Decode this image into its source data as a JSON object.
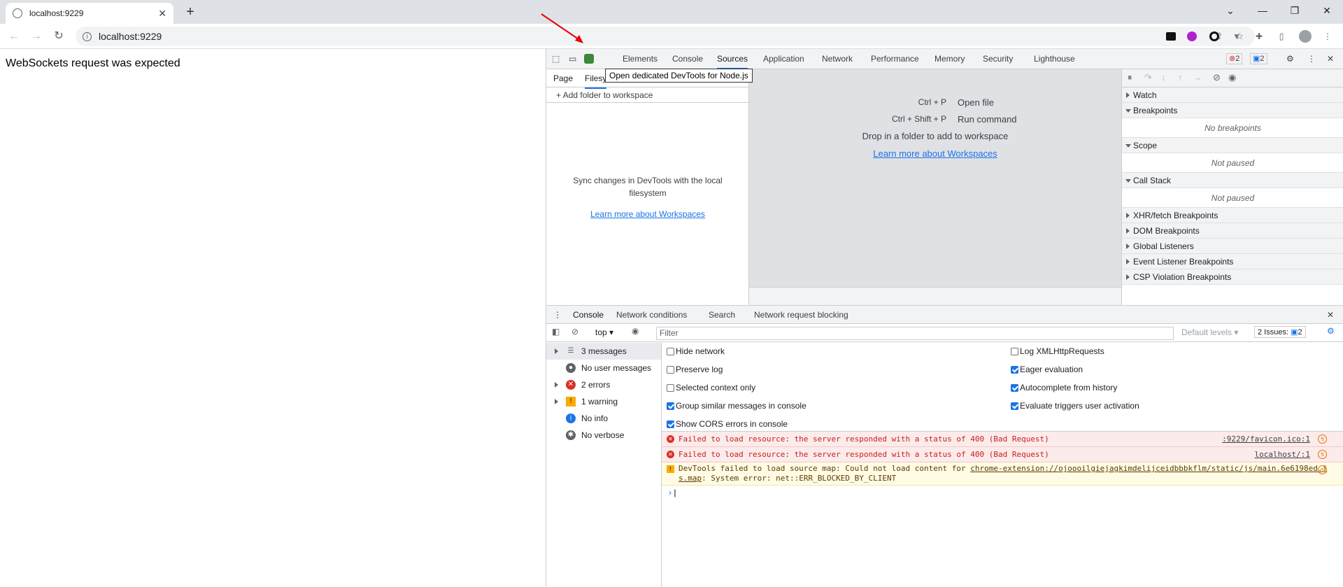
{
  "browser": {
    "tab_title": "localhost:9229",
    "new_tab": "+",
    "url": "localhost:9229"
  },
  "page": {
    "message": "WebSockets request was expected"
  },
  "devtools": {
    "tabs": [
      "Elements",
      "Console",
      "Sources",
      "Application",
      "Network",
      "Performance",
      "Memory",
      "Security",
      "Lighthouse"
    ],
    "active_tab": "Sources",
    "error_count": "2",
    "issue_count": "2",
    "tooltip": "Open dedicated DevTools for Node.js",
    "sources": {
      "nav_tabs": [
        "Page",
        "Filesy"
      ],
      "add_folder": "Add folder to workspace",
      "sync_text_1": "Sync changes in DevTools with the local",
      "sync_text_2": "filesystem",
      "learn_more": "Learn more about Workspaces",
      "shortcuts": [
        {
          "key": "Ctrl + P",
          "label": "Open file"
        },
        {
          "key": "Ctrl + Shift + P",
          "label": "Run command"
        }
      ],
      "drop_text": "Drop in a folder to add to workspace",
      "editor_link": "Learn more about Workspaces"
    },
    "debugger": {
      "watch": "Watch",
      "breakpoints": "Breakpoints",
      "no_breakpoints": "No breakpoints",
      "scope": "Scope",
      "scope_status": "Not paused",
      "call_stack": "Call Stack",
      "call_stack_status": "Not paused",
      "collapsed": [
        "XHR/fetch Breakpoints",
        "DOM Breakpoints",
        "Global Listeners",
        "Event Listener Breakpoints",
        "CSP Violation Breakpoints"
      ]
    },
    "drawer": {
      "tabs": [
        "Console",
        "Network conditions",
        "Search",
        "Network request blocking"
      ],
      "context": "top",
      "filter_placeholder": "Filter",
      "levels": "Default levels",
      "issues": "2 Issues:",
      "issues_count": "2",
      "sidebar": [
        {
          "label": "3 messages",
          "icon": "list-icon"
        },
        {
          "label": "No user messages",
          "icon": "user-icon"
        },
        {
          "label": "2 errors",
          "icon": "error-icon"
        },
        {
          "label": "1 warning",
          "icon": "warning-icon"
        },
        {
          "label": "No info",
          "icon": "info-icon"
        },
        {
          "label": "No verbose",
          "icon": "bug-icon"
        }
      ],
      "settings_left": [
        {
          "label": "Hide network",
          "checked": false
        },
        {
          "label": "Preserve log",
          "checked": false
        },
        {
          "label": "Selected context only",
          "checked": false
        },
        {
          "label": "Group similar messages in console",
          "checked": true
        },
        {
          "label": "Show CORS errors in console",
          "checked": true
        }
      ],
      "settings_right": [
        {
          "label": "Log XMLHttpRequests",
          "checked": false
        },
        {
          "label": "Eager evaluation",
          "checked": true
        },
        {
          "label": "Autocomplete from history",
          "checked": true
        },
        {
          "label": "Evaluate triggers user activation",
          "checked": true
        }
      ],
      "messages": [
        {
          "type": "error",
          "text": "Failed to load resource: the server responded with a status of 400 (Bad Request)",
          "source": ":9229/favicon.ico:1"
        },
        {
          "type": "error",
          "text": "Failed to load resource: the server responded with a status of 400 (Bad Request)",
          "source": "localhost/:1"
        },
        {
          "type": "warning",
          "text_1": "DevTools failed to load source map: Could not load content for ",
          "link_1": "chrome-extension://ojoooilgiejagkimdelijceidbbbkflm/static/js/main.6e6198ed.j",
          "link_2": "s.map",
          "text_2": ": System error: net::ERR_BLOCKED_BY_CLIENT"
        }
      ],
      "prompt": "›"
    }
  },
  "colors": {
    "accent": "#1a73e8",
    "error": "#d93025",
    "warning": "#f9ab00",
    "node_green": "#3c873a"
  }
}
